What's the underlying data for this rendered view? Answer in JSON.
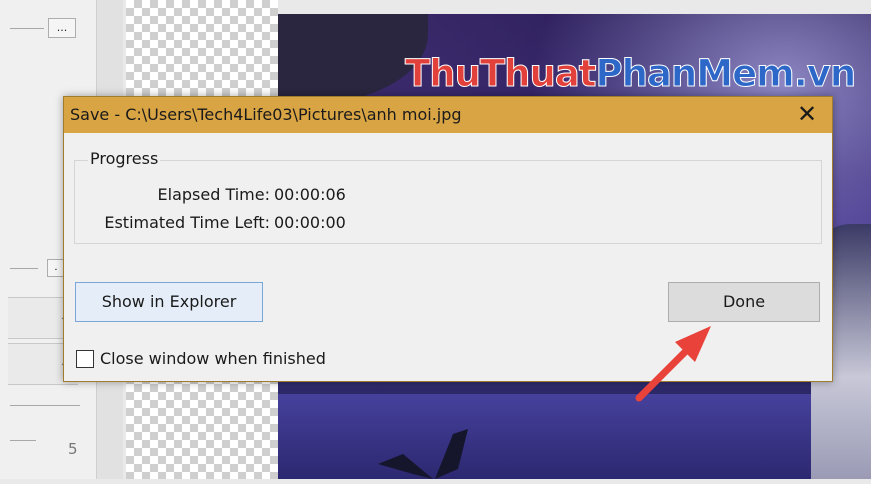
{
  "left_panel": {
    "ellipsis_button": "...",
    "small_button": ".",
    "number": "5"
  },
  "watermark": {
    "part1": "ThuThuat",
    "part2": "PhanMem",
    "part3": ".vn"
  },
  "dialog": {
    "title": "Save - C:\\Users\\Tech4Life03\\Pictures\\anh moi.jpg",
    "close_glyph": "✕",
    "progress": {
      "group_label": "Progress",
      "elapsed_label": "Elapsed Time:",
      "elapsed_value": "00:00:06",
      "estimated_label": "Estimated Time Left:",
      "estimated_value": "00:00:00"
    },
    "buttons": {
      "show_in_explorer": "Show in Explorer",
      "done": "Done"
    },
    "close_when_finished": {
      "label": "Close window when finished",
      "checked": false
    }
  },
  "colors": {
    "titlebar": "#d9a544",
    "annotation_arrow": "#e8423a"
  }
}
